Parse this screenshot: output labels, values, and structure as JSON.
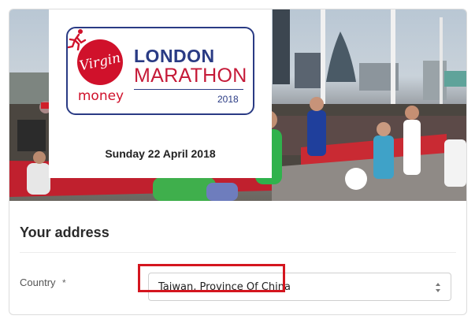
{
  "event": {
    "brand_top": "Virgin",
    "brand_bottom": "money",
    "name_line1": "LONDON",
    "name_line2": "MARATHON",
    "year": "2018",
    "date": "Sunday 22 April 2018"
  },
  "form": {
    "section_title": "Your address",
    "country": {
      "label": "Country",
      "required_mark": "*",
      "value": "Taiwan, Province Of China"
    }
  },
  "colors": {
    "navy": "#2a3b84",
    "virgin_red": "#d0112b",
    "highlight_red": "#d4161f"
  }
}
